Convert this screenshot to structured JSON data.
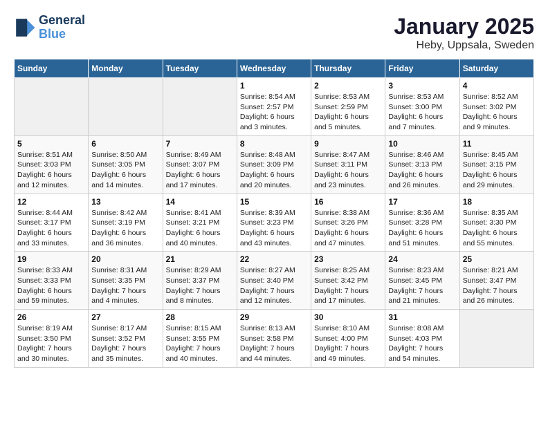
{
  "app": {
    "logo_line1": "General",
    "logo_line2": "Blue"
  },
  "title": "January 2025",
  "subtitle": "Heby, Uppsala, Sweden",
  "weekdays": [
    "Sunday",
    "Monday",
    "Tuesday",
    "Wednesday",
    "Thursday",
    "Friday",
    "Saturday"
  ],
  "weeks": [
    [
      {
        "day": "",
        "info": ""
      },
      {
        "day": "",
        "info": ""
      },
      {
        "day": "",
        "info": ""
      },
      {
        "day": "1",
        "info": "Sunrise: 8:54 AM\nSunset: 2:57 PM\nDaylight: 6 hours and 3 minutes."
      },
      {
        "day": "2",
        "info": "Sunrise: 8:53 AM\nSunset: 2:59 PM\nDaylight: 6 hours and 5 minutes."
      },
      {
        "day": "3",
        "info": "Sunrise: 8:53 AM\nSunset: 3:00 PM\nDaylight: 6 hours and 7 minutes."
      },
      {
        "day": "4",
        "info": "Sunrise: 8:52 AM\nSunset: 3:02 PM\nDaylight: 6 hours and 9 minutes."
      }
    ],
    [
      {
        "day": "5",
        "info": "Sunrise: 8:51 AM\nSunset: 3:03 PM\nDaylight: 6 hours and 12 minutes."
      },
      {
        "day": "6",
        "info": "Sunrise: 8:50 AM\nSunset: 3:05 PM\nDaylight: 6 hours and 14 minutes."
      },
      {
        "day": "7",
        "info": "Sunrise: 8:49 AM\nSunset: 3:07 PM\nDaylight: 6 hours and 17 minutes."
      },
      {
        "day": "8",
        "info": "Sunrise: 8:48 AM\nSunset: 3:09 PM\nDaylight: 6 hours and 20 minutes."
      },
      {
        "day": "9",
        "info": "Sunrise: 8:47 AM\nSunset: 3:11 PM\nDaylight: 6 hours and 23 minutes."
      },
      {
        "day": "10",
        "info": "Sunrise: 8:46 AM\nSunset: 3:13 PM\nDaylight: 6 hours and 26 minutes."
      },
      {
        "day": "11",
        "info": "Sunrise: 8:45 AM\nSunset: 3:15 PM\nDaylight: 6 hours and 29 minutes."
      }
    ],
    [
      {
        "day": "12",
        "info": "Sunrise: 8:44 AM\nSunset: 3:17 PM\nDaylight: 6 hours and 33 minutes."
      },
      {
        "day": "13",
        "info": "Sunrise: 8:42 AM\nSunset: 3:19 PM\nDaylight: 6 hours and 36 minutes."
      },
      {
        "day": "14",
        "info": "Sunrise: 8:41 AM\nSunset: 3:21 PM\nDaylight: 6 hours and 40 minutes."
      },
      {
        "day": "15",
        "info": "Sunrise: 8:39 AM\nSunset: 3:23 PM\nDaylight: 6 hours and 43 minutes."
      },
      {
        "day": "16",
        "info": "Sunrise: 8:38 AM\nSunset: 3:26 PM\nDaylight: 6 hours and 47 minutes."
      },
      {
        "day": "17",
        "info": "Sunrise: 8:36 AM\nSunset: 3:28 PM\nDaylight: 6 hours and 51 minutes."
      },
      {
        "day": "18",
        "info": "Sunrise: 8:35 AM\nSunset: 3:30 PM\nDaylight: 6 hours and 55 minutes."
      }
    ],
    [
      {
        "day": "19",
        "info": "Sunrise: 8:33 AM\nSunset: 3:33 PM\nDaylight: 6 hours and 59 minutes."
      },
      {
        "day": "20",
        "info": "Sunrise: 8:31 AM\nSunset: 3:35 PM\nDaylight: 7 hours and 4 minutes."
      },
      {
        "day": "21",
        "info": "Sunrise: 8:29 AM\nSunset: 3:37 PM\nDaylight: 7 hours and 8 minutes."
      },
      {
        "day": "22",
        "info": "Sunrise: 8:27 AM\nSunset: 3:40 PM\nDaylight: 7 hours and 12 minutes."
      },
      {
        "day": "23",
        "info": "Sunrise: 8:25 AM\nSunset: 3:42 PM\nDaylight: 7 hours and 17 minutes."
      },
      {
        "day": "24",
        "info": "Sunrise: 8:23 AM\nSunset: 3:45 PM\nDaylight: 7 hours and 21 minutes."
      },
      {
        "day": "25",
        "info": "Sunrise: 8:21 AM\nSunset: 3:47 PM\nDaylight: 7 hours and 26 minutes."
      }
    ],
    [
      {
        "day": "26",
        "info": "Sunrise: 8:19 AM\nSunset: 3:50 PM\nDaylight: 7 hours and 30 minutes."
      },
      {
        "day": "27",
        "info": "Sunrise: 8:17 AM\nSunset: 3:52 PM\nDaylight: 7 hours and 35 minutes."
      },
      {
        "day": "28",
        "info": "Sunrise: 8:15 AM\nSunset: 3:55 PM\nDaylight: 7 hours and 40 minutes."
      },
      {
        "day": "29",
        "info": "Sunrise: 8:13 AM\nSunset: 3:58 PM\nDaylight: 7 hours and 44 minutes."
      },
      {
        "day": "30",
        "info": "Sunrise: 8:10 AM\nSunset: 4:00 PM\nDaylight: 7 hours and 49 minutes."
      },
      {
        "day": "31",
        "info": "Sunrise: 8:08 AM\nSunset: 4:03 PM\nDaylight: 7 hours and 54 minutes."
      },
      {
        "day": "",
        "info": ""
      }
    ]
  ]
}
